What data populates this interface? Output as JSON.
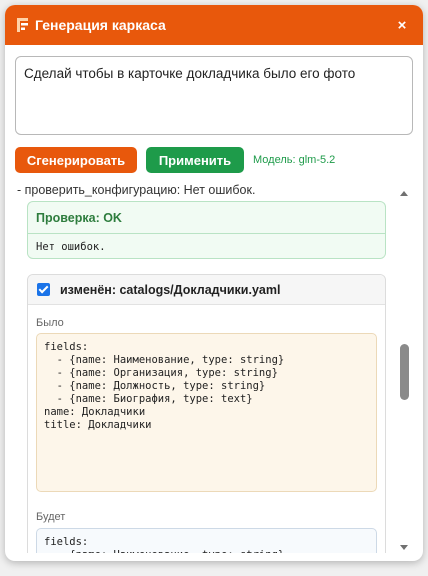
{
  "dialog": {
    "title": "Генерация каркаса",
    "close_glyph": "×",
    "icon": "app-logo-icon"
  },
  "prompt": {
    "value": "Сделай чтобы в карточке докладчика было его фото"
  },
  "actions": {
    "generate_label": "Сгенерировать",
    "apply_label": "Применить",
    "model_text": "Модель: glm-5.2"
  },
  "log": {
    "check_line": "- проверить_конфигурацию: Нет ошибок."
  },
  "check_result": {
    "title": "Проверка: OK",
    "text": "Нет ошибок."
  },
  "file_change": {
    "checked": true,
    "title": "изменён: catalogs/Докладчики.yaml",
    "before_label": "Было",
    "before_code": "fields:\n  - {name: Наименование, type: string}\n  - {name: Организация, type: string}\n  - {name: Должность, type: string}\n  - {name: Биография, type: text}\nname: Докладчики\ntitle: Докладчики",
    "after_label": "Будет",
    "after_code": "fields:\n  - {name: Наименование, type: string}"
  },
  "colors": {
    "accent": "#e8580c",
    "success": "#1e9b4a",
    "ok_bg": "#f1fbf3",
    "before_bg": "#fdf6ea",
    "checkbox": "#1a73e8"
  }
}
